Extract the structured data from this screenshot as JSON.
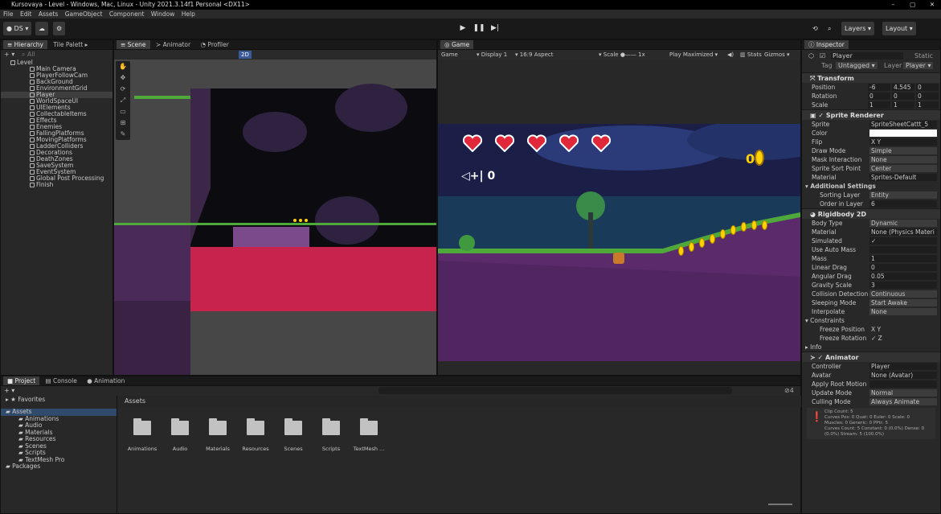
{
  "window": {
    "title": "Kursovaya - Level - Windows, Mac, Linux - Unity 2021.3.14f1 Personal <DX11>",
    "min": "–",
    "max": "▢",
    "close": "✕"
  },
  "menu": [
    "File",
    "Edit",
    "Assets",
    "GameObject",
    "Component",
    "Window",
    "Help"
  ],
  "toolbar": {
    "account": "DS ▾",
    "layers": "Layers",
    "layout": "Layout"
  },
  "hierarchy": {
    "tab": "Hierarchy",
    "tab2": "Tile Palett",
    "search": "All",
    "items": [
      {
        "label": "Level",
        "indent": 0
      },
      {
        "label": "Main Camera",
        "indent": 1
      },
      {
        "label": "PlayerFollowCam",
        "indent": 1
      },
      {
        "label": "BackGround",
        "indent": 1
      },
      {
        "label": "EnvironmentGrid",
        "indent": 1
      },
      {
        "label": "Player",
        "indent": 1,
        "sel": true
      },
      {
        "label": "WorldSpaceUI",
        "indent": 1
      },
      {
        "label": "UIElements",
        "indent": 1
      },
      {
        "label": "CollectableItems",
        "indent": 1
      },
      {
        "label": "Effects",
        "indent": 1
      },
      {
        "label": "Enemies",
        "indent": 1
      },
      {
        "label": "FallingPlatforms",
        "indent": 1
      },
      {
        "label": "MovingPlatforms",
        "indent": 1
      },
      {
        "label": "LadderColliders",
        "indent": 1
      },
      {
        "label": "Decorations",
        "indent": 1
      },
      {
        "label": "DeathZones",
        "indent": 1
      },
      {
        "label": "SaveSystem",
        "indent": 1
      },
      {
        "label": "EventSystem",
        "indent": 1
      },
      {
        "label": "Global Post Processing",
        "indent": 1
      },
      {
        "label": "Finish",
        "indent": 1
      }
    ]
  },
  "scene": {
    "tabs": [
      "Scene",
      "Animator",
      "Profiler"
    ],
    "mode": "2D"
  },
  "game": {
    "tab": "Game",
    "view": "Game",
    "display": "Display 1",
    "aspect": "16:9 Aspect",
    "scale_label": "Scale",
    "scale_value": "1x",
    "play_mode": "Play Maximized",
    "stats": "Stats",
    "gizmos": "Gizmos",
    "hud": {
      "coins": "0",
      "ammo": "0",
      "hearts": 5
    }
  },
  "inspector": {
    "tab": "Inspector",
    "name": "Player",
    "static": "Static",
    "tag_label": "Tag",
    "tag": "Untagged",
    "layer_label": "Layer",
    "layer": "Player",
    "transform": {
      "title": "Transform",
      "position": {
        "label": "Position",
        "x": "-6",
        "y": "4.545",
        "z": "0"
      },
      "rotation": {
        "label": "Rotation",
        "x": "0",
        "y": "0",
        "z": "0"
      },
      "scale": {
        "label": "Scale",
        "x": "1",
        "y": "1",
        "z": "1"
      }
    },
    "sprite_renderer": {
      "title": "Sprite Renderer",
      "rows": [
        {
          "label": "Sprite",
          "value": "SpriteSheetCattt_5"
        },
        {
          "label": "Color",
          "value": ""
        },
        {
          "label": "Flip",
          "value": "X   Y"
        },
        {
          "label": "Draw Mode",
          "value": "Simple"
        },
        {
          "label": "Mask Interaction",
          "value": "None"
        },
        {
          "label": "Sprite Sort Point",
          "value": "Center"
        },
        {
          "label": "Material",
          "value": "Sprites-Default"
        }
      ],
      "additional": "Additional Settings",
      "sorting_layer": {
        "label": "Sorting Layer",
        "value": "Entity"
      },
      "order": {
        "label": "Order in Layer",
        "value": "6"
      }
    },
    "rigidbody": {
      "title": "Rigidbody 2D",
      "rows": [
        {
          "label": "Body Type",
          "value": "Dynamic"
        },
        {
          "label": "Material",
          "value": "None (Physics Materi"
        },
        {
          "label": "Simulated",
          "value": "✓"
        },
        {
          "label": "Use Auto Mass",
          "value": ""
        },
        {
          "label": "Mass",
          "value": "1"
        },
        {
          "label": "Linear Drag",
          "value": "0"
        },
        {
          "label": "Angular Drag",
          "value": "0.05"
        },
        {
          "label": "Gravity Scale",
          "value": "3"
        },
        {
          "label": "Collision Detection",
          "value": "Continuous"
        },
        {
          "label": "Sleeping Mode",
          "value": "Start Awake"
        },
        {
          "label": "Interpolate",
          "value": "None"
        }
      ],
      "constraints": "Constraints",
      "freeze_pos": {
        "label": "Freeze Position",
        "value": "X   Y"
      },
      "freeze_rot": {
        "label": "Freeze Rotation",
        "value": "✓ Z"
      },
      "info": "Info"
    },
    "animator": {
      "title": "Animator",
      "rows": [
        {
          "label": "Controller",
          "value": "Player"
        },
        {
          "label": "Avatar",
          "value": "None (Avatar)"
        },
        {
          "label": "Apply Root Motion",
          "value": ""
        },
        {
          "label": "Update Mode",
          "value": "Normal"
        },
        {
          "label": "Culling Mode",
          "value": "Always Animate"
        }
      ],
      "info_lines": [
        "Clip Count: 5",
        "Curves Pos: 0 Quat: 0 Euler: 0 Scale: 0",
        "Muscles: 0 Generic: 0 PPtr: 5",
        "Curves Count: 5 Constant: 0 (0.0%) Dense: 0",
        "(0.0%) Stream: 5 (100.0%)"
      ]
    }
  },
  "project": {
    "tabs": [
      "Project",
      "Console",
      "Animation"
    ],
    "favorites": "Favorites",
    "tree": [
      "Assets",
      "Animations",
      "Audio",
      "Materials",
      "Resources",
      "Scenes",
      "Scripts",
      "TextMesh Pro",
      "Packages"
    ],
    "breadcrumb": "Assets",
    "count": "4",
    "folders": [
      "Animations",
      "Audio",
      "Materials",
      "Resources",
      "Scenes",
      "Scripts",
      "TextMesh ..."
    ]
  }
}
